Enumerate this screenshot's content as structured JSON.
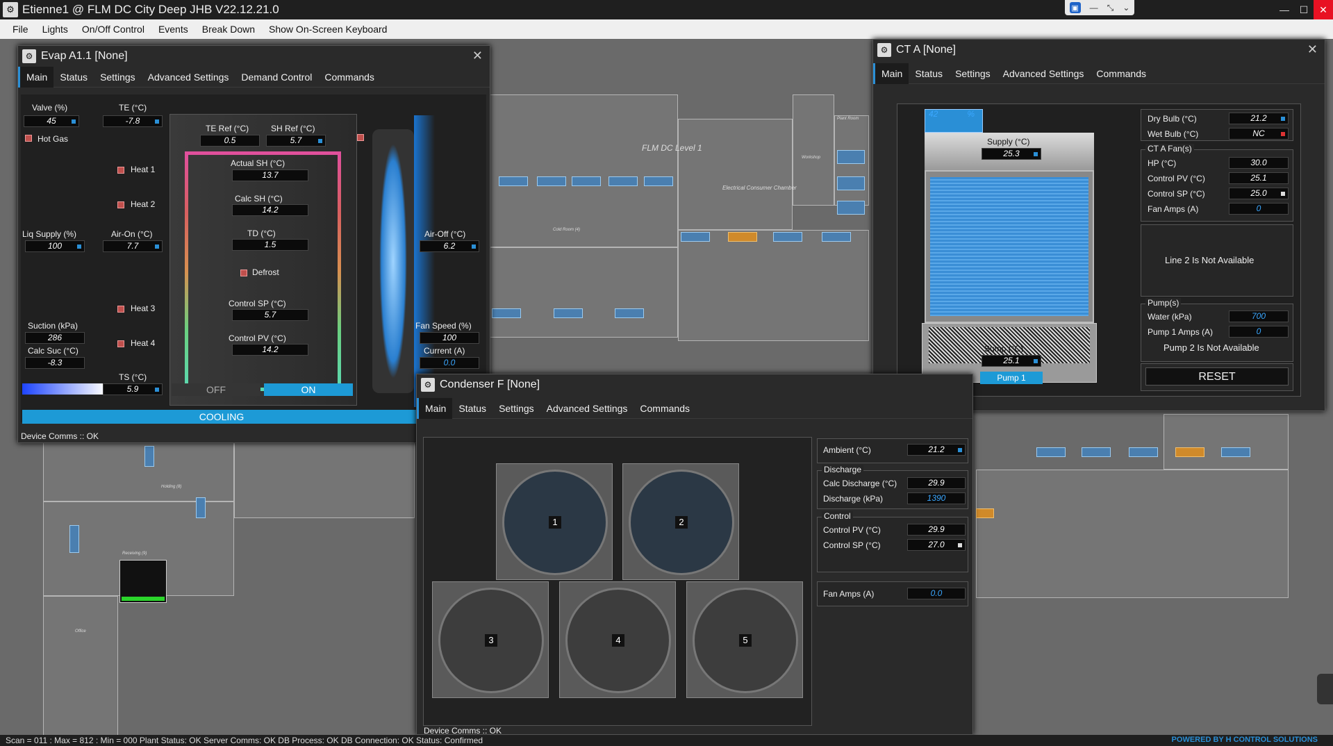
{
  "app": {
    "title": "Etienne1 @ FLM DC City Deep JHB V22.12.21.0"
  },
  "menu": [
    "File",
    "Lights",
    "On/Off Control",
    "Events",
    "Break Down",
    "Show On-Screen Keyboard"
  ],
  "plan": {
    "level_label": "FLM DC Level 1",
    "rooms": {
      "electrical": "Electrical Consumer Chamber",
      "workshop": "Workshop",
      "plant": "Plant Room",
      "cold": "Cold Room (4)",
      "holding": "Holding (8)",
      "receiving": "Receiving (9)",
      "office": "Office"
    }
  },
  "evap": {
    "title": "Evap A1.1 [None]",
    "tabs": [
      "Main",
      "Status",
      "Settings",
      "Advanced Settings",
      "Demand Control",
      "Commands"
    ],
    "valve_label": "Valve (%)",
    "valve": "45",
    "te_label": "TE (°C)",
    "te": "-7.8",
    "hot_gas": "Hot Gas",
    "te_ref_label": "TE Ref (°C)",
    "te_ref": "0.5",
    "sh_ref_label": "SH Ref (°C)",
    "sh_ref": "5.7",
    "heat1": "Heat 1",
    "heat2": "Heat 2",
    "heat3": "Heat 3",
    "heat4": "Heat 4",
    "actual_sh_label": "Actual SH (°C)",
    "actual_sh": "13.7",
    "calc_sh_label": "Calc SH (°C)",
    "calc_sh": "14.2",
    "td_label": "TD (°C)",
    "td": "1.5",
    "defrost": "Defrost",
    "control_sp_label": "Control SP (°C)",
    "control_sp": "5.7",
    "control_pv_label": "Control PV (°C)",
    "control_pv": "14.2",
    "liq_label": "Liq Supply (%)",
    "liq": "100",
    "airon_label": "Air-On (°C)",
    "airon": "7.7",
    "airoff_label": "Air-Off (°C)",
    "airoff": "6.2",
    "suction_label": "Suction (kPa)",
    "suction": "286",
    "calcsuc_label": "Calc Suc (°C)",
    "calcsuc": "-8.3",
    "fanspeed_label": "Fan Speed (%)",
    "fanspeed": "100",
    "current_label": "Current (A)",
    "current": "0.0",
    "ts_label": "TS (°C)",
    "ts": "5.9",
    "off": "OFF",
    "on": "ON",
    "mode": "COOLING",
    "comms": "Device Comms :: OK"
  },
  "cond": {
    "title": "Condenser F [None]",
    "tabs": [
      "Main",
      "Status",
      "Settings",
      "Advanced Settings",
      "Commands"
    ],
    "fans": [
      "1",
      "2",
      "3",
      "4",
      "5"
    ],
    "ambient_label": "Ambient (°C)",
    "ambient": "21.2",
    "discharge_group": "Discharge",
    "calc_dis_label": "Calc Discharge (°C)",
    "calc_dis": "29.9",
    "dis_label": "Discharge (kPa)",
    "dis": "1390",
    "control_group": "Control",
    "pv_label": "Control PV (°C)",
    "pv": "29.9",
    "sp_label": "Control SP (°C)",
    "sp": "27.0",
    "amps_label": "Fan Amps (A)",
    "amps": "0.0",
    "comms": "Device Comms :: OK"
  },
  "ct": {
    "title": "CT A [None]",
    "tabs": [
      "Main",
      "Status",
      "Settings",
      "Advanced Settings",
      "Commands"
    ],
    "fan_pct": "42",
    "pct": "%",
    "supply_label": "Supply (°C)",
    "supply": "25.3",
    "sump_label": "Sump (°C)",
    "sump": "25.1",
    "pump_btn": "Pump 1",
    "dry_label": "Dry Bulb (°C)",
    "dry": "21.2",
    "wet_label": "Wet Bulb (°C)",
    "wet": "NC",
    "fans_group": "CT A Fan(s)",
    "hp_label": "HP (°C)",
    "hp": "30.0",
    "pv_label": "Control PV (°C)",
    "pv": "25.1",
    "sp_label": "Control SP (°C)",
    "sp": "25.0",
    "amps_label": "Fan Amps (A)",
    "amps": "0",
    "line2": "Line 2 Is Not Available",
    "pumps_group": "Pump(s)",
    "water_label": "Water (kPa)",
    "water": "700",
    "pamps_label": "Pump 1 Amps (A)",
    "pamps": "0",
    "pump2": "Pump 2 Is Not Available",
    "reset": "RESET"
  },
  "status": {
    "text": "Scan = 011 : Max = 812 : Min = 000    Plant Status: OK    Server Comms: OK    DB Process: OK    DB Connection: OK    Status: Confirmed",
    "powered": "POWERED BY H CONTROL SOLUTIONS"
  }
}
